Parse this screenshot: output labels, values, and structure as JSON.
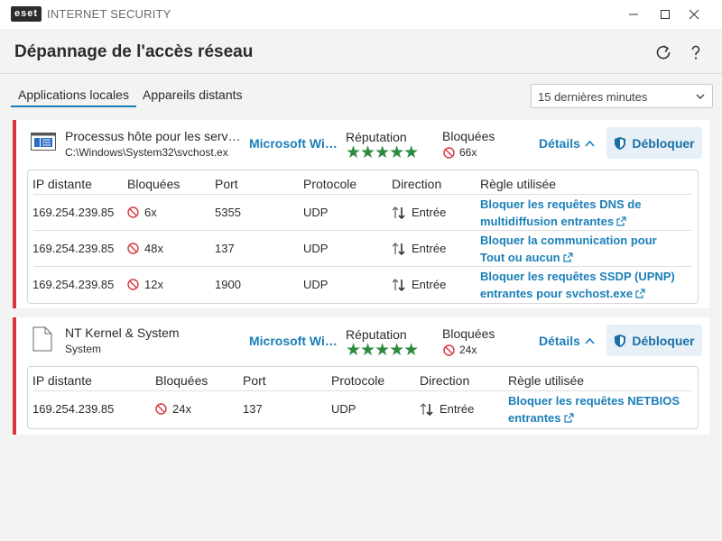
{
  "titlebar": {
    "logo": "eset",
    "product": "INTERNET SECURITY"
  },
  "header": {
    "title": "Dépannage de l'accès réseau"
  },
  "tabs": [
    {
      "label": "Applications locales",
      "active": true
    },
    {
      "label": "Appareils distants",
      "active": false
    }
  ],
  "time_filter": {
    "value": "15 dernières minutes"
  },
  "labels": {
    "reputation": "Réputation",
    "blocked": "Bloquées",
    "details": "Détails",
    "unblock": "Débloquer",
    "col_ip": "IP distante",
    "col_blocked": "Bloquées",
    "col_port": "Port",
    "col_protocol": "Protocole",
    "col_direction": "Direction",
    "col_rule": "Règle utilisée"
  },
  "apps": [
    {
      "name": "Processus hôte pour les serv…",
      "path": "C:\\Windows\\System32\\svchost.ex",
      "vendor": "Microsoft Wi…",
      "stars": "★★★★★",
      "blocked": "66x",
      "rows": [
        {
          "ip": "169.254.239.85",
          "blocked": "6x",
          "port": "5355",
          "protocol": "UDP",
          "direction": "Entrée",
          "rule_line1": "Bloquer les requêtes DNS de",
          "rule_line2": "multidiffusion entrantes"
        },
        {
          "ip": "169.254.239.85",
          "blocked": "48x",
          "port": "137",
          "protocol": "UDP",
          "direction": "Entrée",
          "rule_line1": "Bloquer la communication pour",
          "rule_line2": "Tout ou aucun"
        },
        {
          "ip": "169.254.239.85",
          "blocked": "12x",
          "port": "1900",
          "protocol": "UDP",
          "direction": "Entrée",
          "rule_line1": "Bloquer les requêtes SSDP (UPNP)",
          "rule_line2": "entrantes pour svchost.exe"
        }
      ]
    },
    {
      "name": "NT Kernel & System",
      "path": "System",
      "vendor": "Microsoft Wi…",
      "stars": "★★★★★",
      "blocked": "24x",
      "rows": [
        {
          "ip": "169.254.239.85",
          "blocked": "24x",
          "port": "137",
          "protocol": "UDP",
          "direction": "Entrée",
          "rule_line1": "Bloquer les requêtes NETBIOS",
          "rule_line2": "entrantes"
        }
      ]
    }
  ],
  "colors": {
    "accent": "#1a7fb8",
    "alert_bar": "#d9363e",
    "reputation_green": "#2e8b3e",
    "block_red": "#d9363e"
  }
}
